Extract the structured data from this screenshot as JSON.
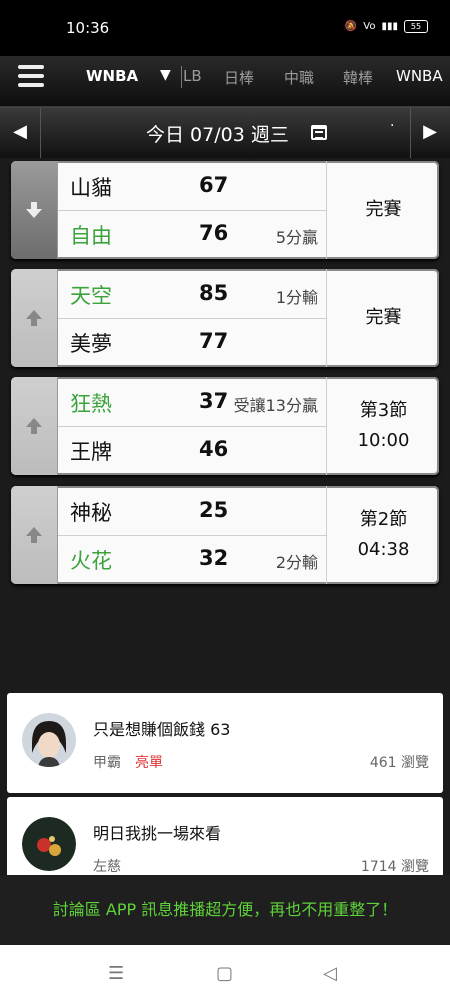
{
  "status_bar": {
    "time": "10:36",
    "icons": [
      "mute-icon",
      "volte-icon",
      "4g-icon",
      "signal-icon"
    ],
    "battery": "55"
  },
  "top_nav": {
    "tabs": [
      {
        "label": "WNBA",
        "active": true
      },
      {
        "label": "LB",
        "active": false
      },
      {
        "label": "日棒",
        "active": false
      },
      {
        "label": "中職",
        "active": false
      },
      {
        "label": "韓棒",
        "active": false
      },
      {
        "label": "WNBA",
        "active": false
      }
    ],
    "dropdown_icon": "triangle-down-icon"
  },
  "date_bar": {
    "prev": "◀",
    "next": "▶",
    "label": "今日 07/03 週三",
    "dot": "·"
  },
  "games": [
    {
      "arrow": "down",
      "team1": {
        "name": "山貓",
        "score": "67",
        "note": "",
        "win": false
      },
      "team2": {
        "name": "自由",
        "score": "76",
        "note": "5分贏",
        "win": true
      },
      "status_line1": "完賽",
      "status_line2": ""
    },
    {
      "arrow": "up",
      "team1": {
        "name": "天空",
        "score": "85",
        "note": "1分輸",
        "win": true
      },
      "team2": {
        "name": "美夢",
        "score": "77",
        "note": "",
        "win": false
      },
      "status_line1": "完賽",
      "status_line2": ""
    },
    {
      "arrow": "up",
      "team1": {
        "name": "狂熱",
        "score": "37",
        "note": "受讓13分贏",
        "win": true
      },
      "team2": {
        "name": "王牌",
        "score": "46",
        "note": "",
        "win": false
      },
      "status_line1": "第3節",
      "status_line2": "10:00"
    },
    {
      "arrow": "up",
      "team1": {
        "name": "神秘",
        "score": "25",
        "note": "",
        "win": false
      },
      "team2": {
        "name": "火花",
        "score": "32",
        "note": "2分輸",
        "win": true
      },
      "status_line1": "第2節",
      "status_line2": "04:38"
    }
  ],
  "posts": [
    {
      "title": "只是想賺個飯錢 63",
      "author": "甲霸",
      "tag": "亮單",
      "views": "461 瀏覽"
    },
    {
      "title": "明日我挑一場來看",
      "author": "左慈",
      "tag": "",
      "views": "1714 瀏覽"
    }
  ],
  "banner": {
    "text": "討論區 APP 訊息推播超方便，再也不用重整了！"
  },
  "system_nav": {
    "menu": "☰",
    "home": "▢",
    "back": "◁"
  },
  "colors": {
    "win_green": "#3ca33c",
    "tag_red": "#dd3333",
    "banner_green": "#5fd33a"
  }
}
